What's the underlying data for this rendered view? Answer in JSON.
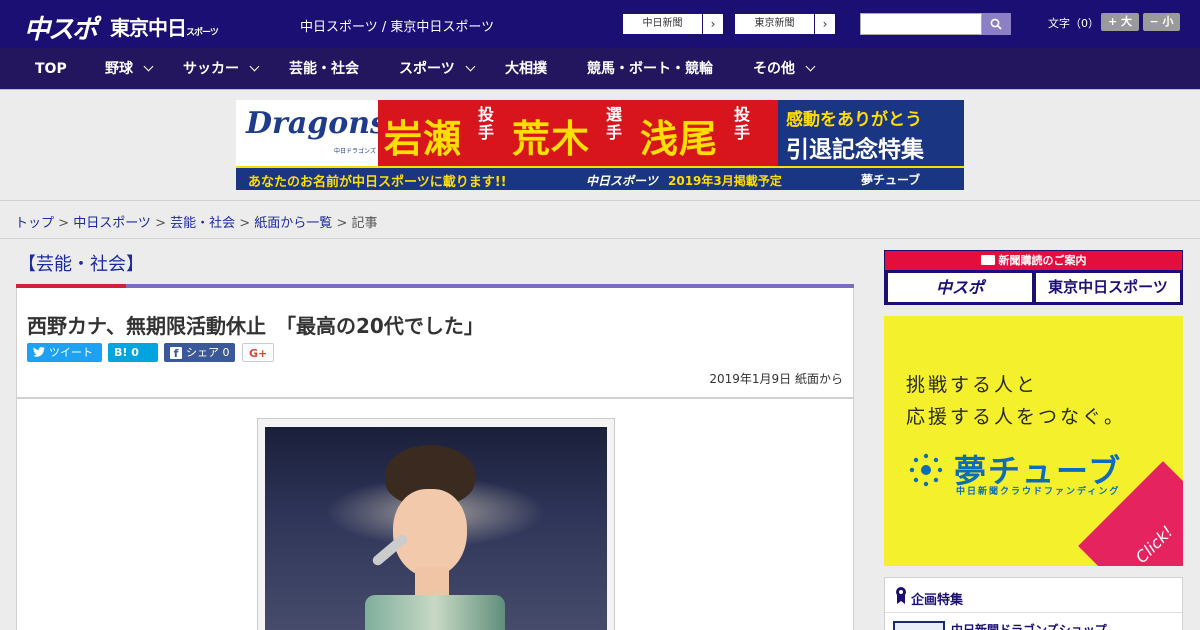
{
  "header": {
    "logo_chuspo": "中スポ",
    "logo_tokyo": "東京中日",
    "logo_tokyo_suffix": "スポーツ",
    "site_title": "中日スポーツ / 東京中日スポーツ",
    "paper_links": [
      {
        "label": "中日新聞"
      },
      {
        "label": "東京新聞"
      }
    ],
    "search": {
      "placeholder": "",
      "value": ""
    },
    "font_size_label": "文字（0）",
    "font_bigger": "+ 大",
    "font_smaller": "− 小"
  },
  "nav": {
    "items": [
      {
        "label": "TOP",
        "has_menu": false
      },
      {
        "label": "野球",
        "has_menu": true
      },
      {
        "label": "サッカー",
        "has_menu": true
      },
      {
        "label": "芸能・社会",
        "has_menu": false
      },
      {
        "label": "スポーツ",
        "has_menu": true
      },
      {
        "label": "大相撲",
        "has_menu": false
      },
      {
        "label": "競馬・ボート・競輪",
        "has_menu": false
      },
      {
        "label": "その他",
        "has_menu": true
      }
    ]
  },
  "banner": {
    "team": "Dragons",
    "team_sub": "中日ドラゴンズ",
    "players": [
      {
        "name": "岩瀬",
        "role": "投手"
      },
      {
        "name": "荒木",
        "role": "選手"
      },
      {
        "name": "浅尾",
        "role": "投手"
      }
    ],
    "thanks": "感動をありがとう",
    "feature": "引退記念特集",
    "strip_text": "あなたのお名前が中日スポーツに載ります!!",
    "strip_brand": "中日スポーツ",
    "strip_date": "2019年3月掲載予定",
    "strip_partner": "夢チューブ"
  },
  "breadcrumb": {
    "items": [
      "トップ",
      "中日スポーツ",
      "芸能・社会",
      "紙面から一覧"
    ],
    "current": "記事"
  },
  "article": {
    "section": "【芸能・社会】",
    "headline": "西野カナ、無期限活動休止　「最高の20代でした」",
    "share": {
      "tweet": "ツイート",
      "hatena": "B! 0",
      "facebook": "シェア 0",
      "gplus": "G+"
    },
    "dateline": "2019年1月9日 紙面から"
  },
  "sidebar": {
    "subscribe_title": "新聞購読のご案内",
    "subscribe_options": [
      "中スポ",
      "東京中日スポーツ"
    ],
    "ad_line1": "挑戦する人と",
    "ad_line2": "応援する人をつなぐ。",
    "ad_brand": "夢チューブ",
    "ad_sub": "中日新聞クラウドファンディング",
    "ad_click": "Click!",
    "feature_title": "企画特集",
    "feature_item": "中日新聞ドラゴンズショップ"
  }
}
